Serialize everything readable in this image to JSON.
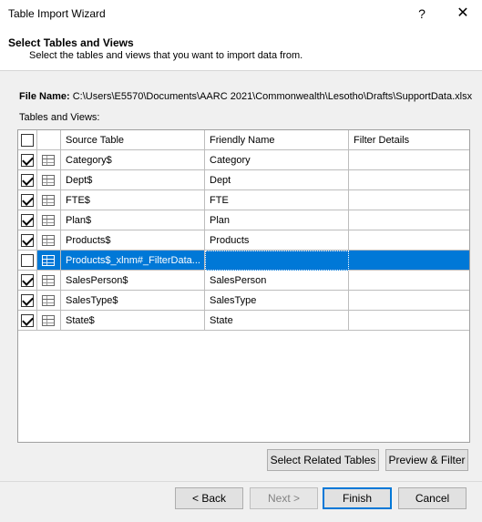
{
  "window": {
    "title": "Table Import Wizard",
    "help": "?",
    "close": "✕"
  },
  "header": {
    "title": "Select Tables and Views",
    "subtitle": "Select the tables and views that you want to import data from."
  },
  "file": {
    "label": "File Name:",
    "path": "C:\\Users\\E5570\\Documents\\AARC 2021\\Commonwealth\\Lesotho\\Drafts\\SupportData.xlsx"
  },
  "tables_label": "Tables and Views:",
  "grid": {
    "columns": [
      "Source Table",
      "Friendly Name",
      "Filter Details"
    ],
    "rows": [
      {
        "checked": true,
        "source": "Category$",
        "friendly": "Category",
        "filter": "",
        "selected": false
      },
      {
        "checked": true,
        "source": "Dept$",
        "friendly": "Dept",
        "filter": "",
        "selected": false
      },
      {
        "checked": true,
        "source": "FTE$",
        "friendly": "FTE",
        "filter": "",
        "selected": false
      },
      {
        "checked": true,
        "source": "Plan$",
        "friendly": "Plan",
        "filter": "",
        "selected": false
      },
      {
        "checked": true,
        "source": "Products$",
        "friendly": "Products",
        "filter": "",
        "selected": false
      },
      {
        "checked": false,
        "source": "Products$_xlnm#_FilterData...",
        "friendly": "",
        "filter": "",
        "selected": true
      },
      {
        "checked": true,
        "source": "SalesPerson$",
        "friendly": "SalesPerson",
        "filter": "",
        "selected": false
      },
      {
        "checked": true,
        "source": "SalesType$",
        "friendly": "SalesType",
        "filter": "",
        "selected": false
      },
      {
        "checked": true,
        "source": "State$",
        "friendly": "State",
        "filter": "",
        "selected": false
      }
    ]
  },
  "buttons": {
    "select_related": "Select Related Tables",
    "preview_filter": "Preview & Filter",
    "back": "< Back",
    "next": "Next >",
    "finish": "Finish",
    "cancel": "Cancel"
  },
  "colors": {
    "selection": "#0078d7"
  }
}
